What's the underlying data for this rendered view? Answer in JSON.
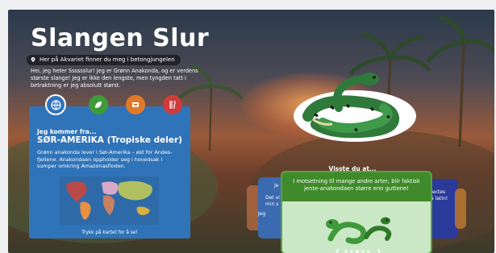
{
  "header": {
    "title": "Slangen Slur",
    "location": "Her på Akvariet finner du meg i betongjungelen",
    "intro": "Hei, jeg heter Sssssslur! Jeg er Grønn Anakonda, og er verdens største slange! Jeg er ikke den lengste, men tyngden tatt i betraktning er jeg absolutt størst."
  },
  "tabs": [
    {
      "icon": "globe-icon",
      "color": "#2f73b8",
      "active": true
    },
    {
      "icon": "leaf-icon",
      "color": "#3f9a3a",
      "active": false
    },
    {
      "icon": "food-bowl-icon",
      "color": "#e07a2a",
      "active": false
    },
    {
      "icon": "fork-knife-icon",
      "color": "#d03a3a",
      "active": false
    }
  ],
  "panel": {
    "kicker": "Jeg kommer fra...",
    "region": "SØR-AMERIKA (Tropiske deler)",
    "body": "Grønn anakonda lever i Sør-Amerika – øst for Andes-fjellene. Anakondaen oppholder seg i hovedsak i sumper omkring Amazonasfloden.",
    "map_caption": "Trykk på kartet for å se!"
  },
  "facts": {
    "heading": "Visste du at...",
    "main": "I motsetning til mange andre arter, blir faktisk jente-anakondaen større enn guttene!",
    "left_partial_1": "Je",
    "left_partial_2": "Det vi",
    "left_partial_3": "min s",
    "left_partial_4": "Jeg",
    "right_partial_1": "ectes",
    "right_partial_2": "å latin!"
  },
  "carousel": {
    "count": 5,
    "active": 2
  }
}
